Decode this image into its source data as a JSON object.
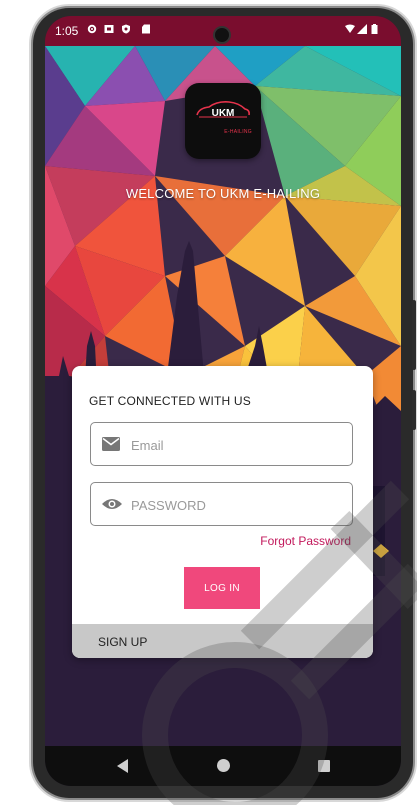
{
  "status_bar": {
    "time": "1:05",
    "bg_color": "#7a0d2e",
    "left_icons": [
      "settings-icon",
      "keyboard-icon",
      "shield-icon",
      "sd-card-icon"
    ],
    "right_icons": [
      "wifi-icon",
      "signal-icon",
      "battery-icon"
    ]
  },
  "logo": {
    "name": "UKM",
    "subtitle": "E-HAILING"
  },
  "welcome_text": "WELCOME TO UKM E-HAILING",
  "login_card": {
    "title": "GET CONNECTED WITH US",
    "email_placeholder": "Email",
    "password_placeholder": "PASSWORD",
    "forgot_password": "Forgot Password",
    "login_label": "LOG IN",
    "signup_label": "SIGN UP",
    "accent_color": "#f0487c"
  },
  "nav_bar": {
    "items": [
      "back-icon",
      "home-icon",
      "recents-icon"
    ]
  }
}
